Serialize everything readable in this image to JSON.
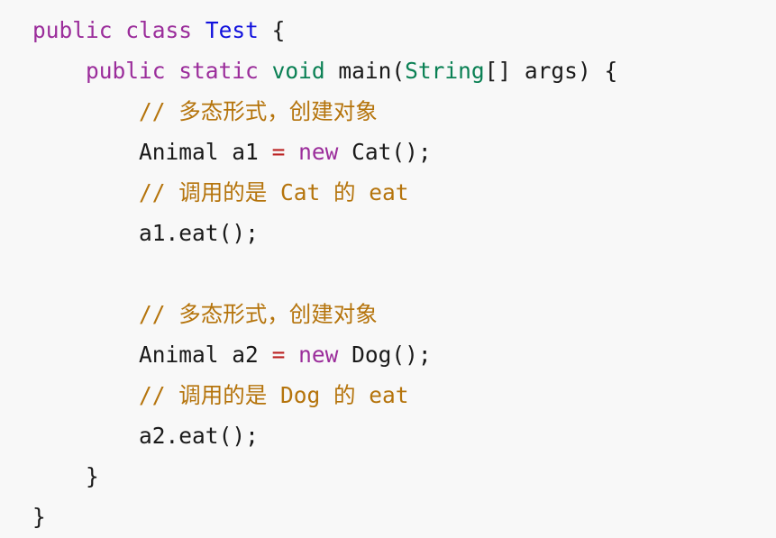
{
  "editor": {
    "language": "java",
    "background_color": "#f8f8f8",
    "default_text_color": "#1a1a1a",
    "theme_colors": {
      "keyword": "#9b2d9b",
      "type": "#1111dd",
      "builtin_type": "#0a8054",
      "comment": "#b5740c",
      "operator": "#bb2222",
      "plain": "#1a1a1a"
    },
    "lines": [
      {
        "index": 1,
        "indent": 0,
        "tokens": [
          {
            "text": "public",
            "kind": "keyword"
          },
          {
            "text": " ",
            "kind": "plain"
          },
          {
            "text": "class",
            "kind": "keyword"
          },
          {
            "text": " ",
            "kind": "plain"
          },
          {
            "text": "Test",
            "kind": "type"
          },
          {
            "text": " ",
            "kind": "plain"
          },
          {
            "text": "{",
            "kind": "punct"
          }
        ]
      },
      {
        "index": 2,
        "indent": 4,
        "tokens": [
          {
            "text": "public",
            "kind": "keyword"
          },
          {
            "text": " ",
            "kind": "plain"
          },
          {
            "text": "static",
            "kind": "keyword"
          },
          {
            "text": " ",
            "kind": "plain"
          },
          {
            "text": "void",
            "kind": "builtin"
          },
          {
            "text": " ",
            "kind": "plain"
          },
          {
            "text": "main",
            "kind": "plain"
          },
          {
            "text": "(",
            "kind": "punct"
          },
          {
            "text": "String",
            "kind": "builtin"
          },
          {
            "text": "[] ",
            "kind": "punct"
          },
          {
            "text": "args",
            "kind": "plain"
          },
          {
            "text": ") ",
            "kind": "punct"
          },
          {
            "text": "{",
            "kind": "punct"
          }
        ]
      },
      {
        "index": 3,
        "indent": 8,
        "tokens": [
          {
            "text": "// ",
            "kind": "comment"
          },
          {
            "text": "多态形式，创建对象",
            "kind": "comment",
            "cjk": true
          }
        ]
      },
      {
        "index": 4,
        "indent": 8,
        "tokens": [
          {
            "text": "Animal",
            "kind": "plain"
          },
          {
            "text": " ",
            "kind": "plain"
          },
          {
            "text": "a1",
            "kind": "plain"
          },
          {
            "text": " ",
            "kind": "plain"
          },
          {
            "text": "=",
            "kind": "operator"
          },
          {
            "text": " ",
            "kind": "plain"
          },
          {
            "text": "new",
            "kind": "keyword"
          },
          {
            "text": " ",
            "kind": "plain"
          },
          {
            "text": "Cat",
            "kind": "plain"
          },
          {
            "text": "();",
            "kind": "punct"
          }
        ]
      },
      {
        "index": 5,
        "indent": 8,
        "tokens": [
          {
            "text": "// ",
            "kind": "comment"
          },
          {
            "text": "调用的是",
            "kind": "comment",
            "cjk": true
          },
          {
            "text": " Cat ",
            "kind": "comment"
          },
          {
            "text": "的",
            "kind": "comment",
            "cjk": true
          },
          {
            "text": " eat",
            "kind": "comment"
          }
        ]
      },
      {
        "index": 6,
        "indent": 8,
        "tokens": [
          {
            "text": "a1",
            "kind": "plain"
          },
          {
            "text": ".",
            "kind": "punct"
          },
          {
            "text": "eat",
            "kind": "plain"
          },
          {
            "text": "();",
            "kind": "punct"
          }
        ]
      },
      {
        "index": 7,
        "indent": 0,
        "blank": true,
        "tokens": []
      },
      {
        "index": 8,
        "indent": 8,
        "tokens": [
          {
            "text": "// ",
            "kind": "comment"
          },
          {
            "text": "多态形式，创建对象",
            "kind": "comment",
            "cjk": true
          }
        ]
      },
      {
        "index": 9,
        "indent": 8,
        "tokens": [
          {
            "text": "Animal",
            "kind": "plain"
          },
          {
            "text": " ",
            "kind": "plain"
          },
          {
            "text": "a2",
            "kind": "plain"
          },
          {
            "text": " ",
            "kind": "plain"
          },
          {
            "text": "=",
            "kind": "operator"
          },
          {
            "text": " ",
            "kind": "plain"
          },
          {
            "text": "new",
            "kind": "keyword"
          },
          {
            "text": " ",
            "kind": "plain"
          },
          {
            "text": "Dog",
            "kind": "plain"
          },
          {
            "text": "();",
            "kind": "punct"
          }
        ]
      },
      {
        "index": 10,
        "indent": 8,
        "tokens": [
          {
            "text": "// ",
            "kind": "comment"
          },
          {
            "text": "调用的是",
            "kind": "comment",
            "cjk": true
          },
          {
            "text": " Dog ",
            "kind": "comment"
          },
          {
            "text": "的",
            "kind": "comment",
            "cjk": true
          },
          {
            "text": " eat",
            "kind": "comment"
          }
        ]
      },
      {
        "index": 11,
        "indent": 8,
        "tokens": [
          {
            "text": "a2",
            "kind": "plain"
          },
          {
            "text": ".",
            "kind": "punct"
          },
          {
            "text": "eat",
            "kind": "plain"
          },
          {
            "text": "();",
            "kind": "punct"
          }
        ]
      },
      {
        "index": 12,
        "indent": 4,
        "tokens": [
          {
            "text": "}",
            "kind": "punct"
          }
        ]
      },
      {
        "index": 13,
        "indent": 0,
        "tokens": [
          {
            "text": "}",
            "kind": "punct"
          }
        ]
      }
    ]
  }
}
